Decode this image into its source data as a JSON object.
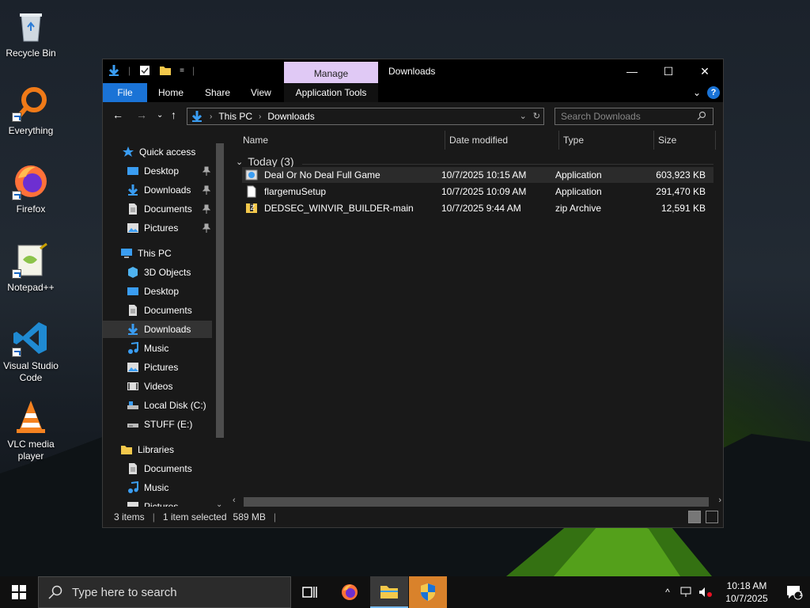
{
  "desktop": {
    "icons": [
      {
        "label": "Recycle Bin"
      },
      {
        "label": "Everything"
      },
      {
        "label": "Firefox"
      },
      {
        "label": "Notepad++"
      },
      {
        "label": "Visual Studio Code"
      },
      {
        "label": "VLC media player"
      }
    ]
  },
  "window": {
    "title": "Downloads",
    "contextual_tab": "Manage",
    "ribbon_tabs": {
      "file": "File",
      "home": "Home",
      "share": "Share",
      "view": "View",
      "app_tools": "Application Tools"
    },
    "address": {
      "root": "This PC",
      "current": "Downloads"
    },
    "search_placeholder": "Search Downloads",
    "nav": {
      "quick_access": "Quick access",
      "quick_items": [
        "Desktop",
        "Downloads",
        "Documents",
        "Pictures"
      ],
      "this_pc": "This PC",
      "pc_items": [
        "3D Objects",
        "Desktop",
        "Documents",
        "Downloads",
        "Music",
        "Pictures",
        "Videos",
        "Local Disk (C:)",
        "STUFF (E:)"
      ],
      "libraries": "Libraries",
      "lib_items": [
        "Documents",
        "Music",
        "Pictures"
      ]
    },
    "columns": {
      "name": "Name",
      "date": "Date modified",
      "type": "Type",
      "size": "Size"
    },
    "group": "Today (3)",
    "files": [
      {
        "name": "Deal Or No Deal Full Game",
        "date": "10/7/2025 10:15 AM",
        "type": "Application",
        "size": "603,923 KB",
        "icon": "installer-icon"
      },
      {
        "name": "flargemuSetup",
        "date": "10/7/2025 10:09 AM",
        "type": "Application",
        "size": "291,470 KB",
        "icon": "file-icon"
      },
      {
        "name": "DEDSEC_WINVIR_BUILDER-main",
        "date": "10/7/2025 9:44 AM",
        "type": "zip Archive",
        "size": "12,591 KB",
        "icon": "zip-icon"
      }
    ],
    "status": {
      "items": "3 items",
      "selected": "1 item selected",
      "size": "589 MB"
    }
  },
  "taskbar": {
    "search_placeholder": "Type here to search",
    "time": "10:18 AM",
    "date": "10/7/2025",
    "notification_count": "1"
  },
  "colors": {
    "accent": "#1a73d6",
    "manage_tab": "#e0c9f5",
    "uac": "#d9822b"
  }
}
